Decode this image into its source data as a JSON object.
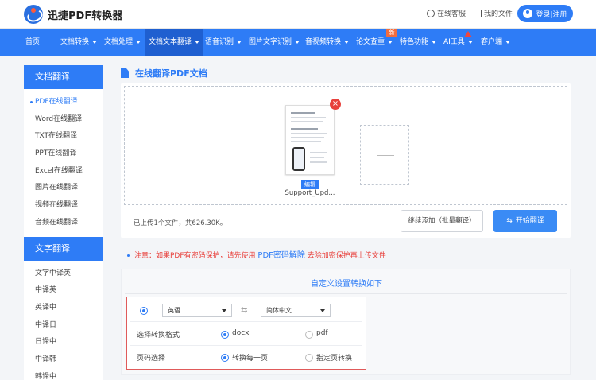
{
  "header": {
    "brand": "迅捷PDF转换器",
    "service": "在线客服",
    "my_files": "我的文件",
    "login": "登录|注册"
  },
  "nav": {
    "items": [
      "首页",
      "文档转换",
      "文档处理",
      "文档文本翻译",
      "语音识别",
      "图片文字识别",
      "音视频转换",
      "论文查重",
      "特色功能",
      "AI工具",
      "客户端"
    ],
    "badge_new": "新"
  },
  "sidebar": {
    "section1": "文档翻译",
    "items1": [
      "PDF在线翻译",
      "Word在线翻译",
      "TXT在线翻译",
      "PPT在线翻译",
      "Excel在线翻译",
      "图片在线翻译",
      "视频在线翻译",
      "音频在线翻译"
    ],
    "section2": "文字翻译",
    "items2": [
      "文字中译英",
      "中译英",
      "英译中",
      "中译日",
      "日译中",
      "中译韩",
      "韩译中"
    ]
  },
  "main": {
    "title": "在线翻译PDF文档",
    "file_name": "Support_Upd...",
    "edit_label": "编辑",
    "upload_info": "已上传1个文件，共626.30K。",
    "continue_label": "继续添加（批量翻译）",
    "start_label": "开始翻译",
    "notice_prefix": "注意：如果PDF有密码保护，请先使用",
    "notice_link": "PDF密码解除",
    "notice_suffix": "去除加密保护再上传文件"
  },
  "settings": {
    "title": "自定义设置转换如下",
    "source_lang": "英语",
    "target_lang": "简体中文",
    "format_label": "选择转换格式",
    "format_docx": "docx",
    "format_pdf": "pdf",
    "page_label": "页码选择",
    "page_all": "转换每一页",
    "page_specific": "指定页转换"
  },
  "colors": {
    "primary": "#2e7cf6",
    "danger": "#e8413c"
  }
}
